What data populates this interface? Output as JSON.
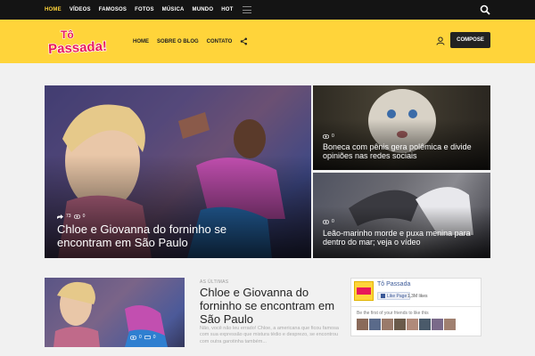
{
  "topnav": {
    "items": [
      "HOME",
      "VÍDEOS",
      "FAMOSOS",
      "FOTOS",
      "MÚSICA",
      "MUNDO",
      "HOT"
    ],
    "active": "HOME"
  },
  "header": {
    "logo_text": "Tô Passada!",
    "nav": [
      "HOME",
      "SOBRE O BLOG",
      "CONTATO"
    ],
    "compose_label": "COMPOSE"
  },
  "featured": {
    "hero": {
      "title": "Chloe e Giovanna do forninho se encontram em São Paulo",
      "shares": "73",
      "views": "0"
    },
    "side1": {
      "title": "Boneca com pênis gera polêmica e divide opiniões nas redes sociais",
      "views": "0"
    },
    "side2": {
      "title": "Leão-marinho morde e puxa menina para dentro do mar; veja o vídeo",
      "views": "0"
    }
  },
  "latest": {
    "label": "AS ÚLTIMAS",
    "title": "Chloe e Giovanna do forninho se encontram em São Paulo",
    "excerpt": "Não, você não leu errado! Chloe, a americana que ficou famosa com sua expressão que mistura tédio e desprezo, se encontrou com outra garotinha também...",
    "views": "0",
    "count2": "0"
  },
  "facebook": {
    "page_name": "Tô Passada",
    "like_label": "Like Page",
    "likes": "1,3M likes",
    "friends_text": "Be the first of your friends to like this"
  },
  "colors": {
    "brand_yellow": "#ffd43a",
    "topbar": "#141414",
    "logo_pink": "#e8185a"
  }
}
